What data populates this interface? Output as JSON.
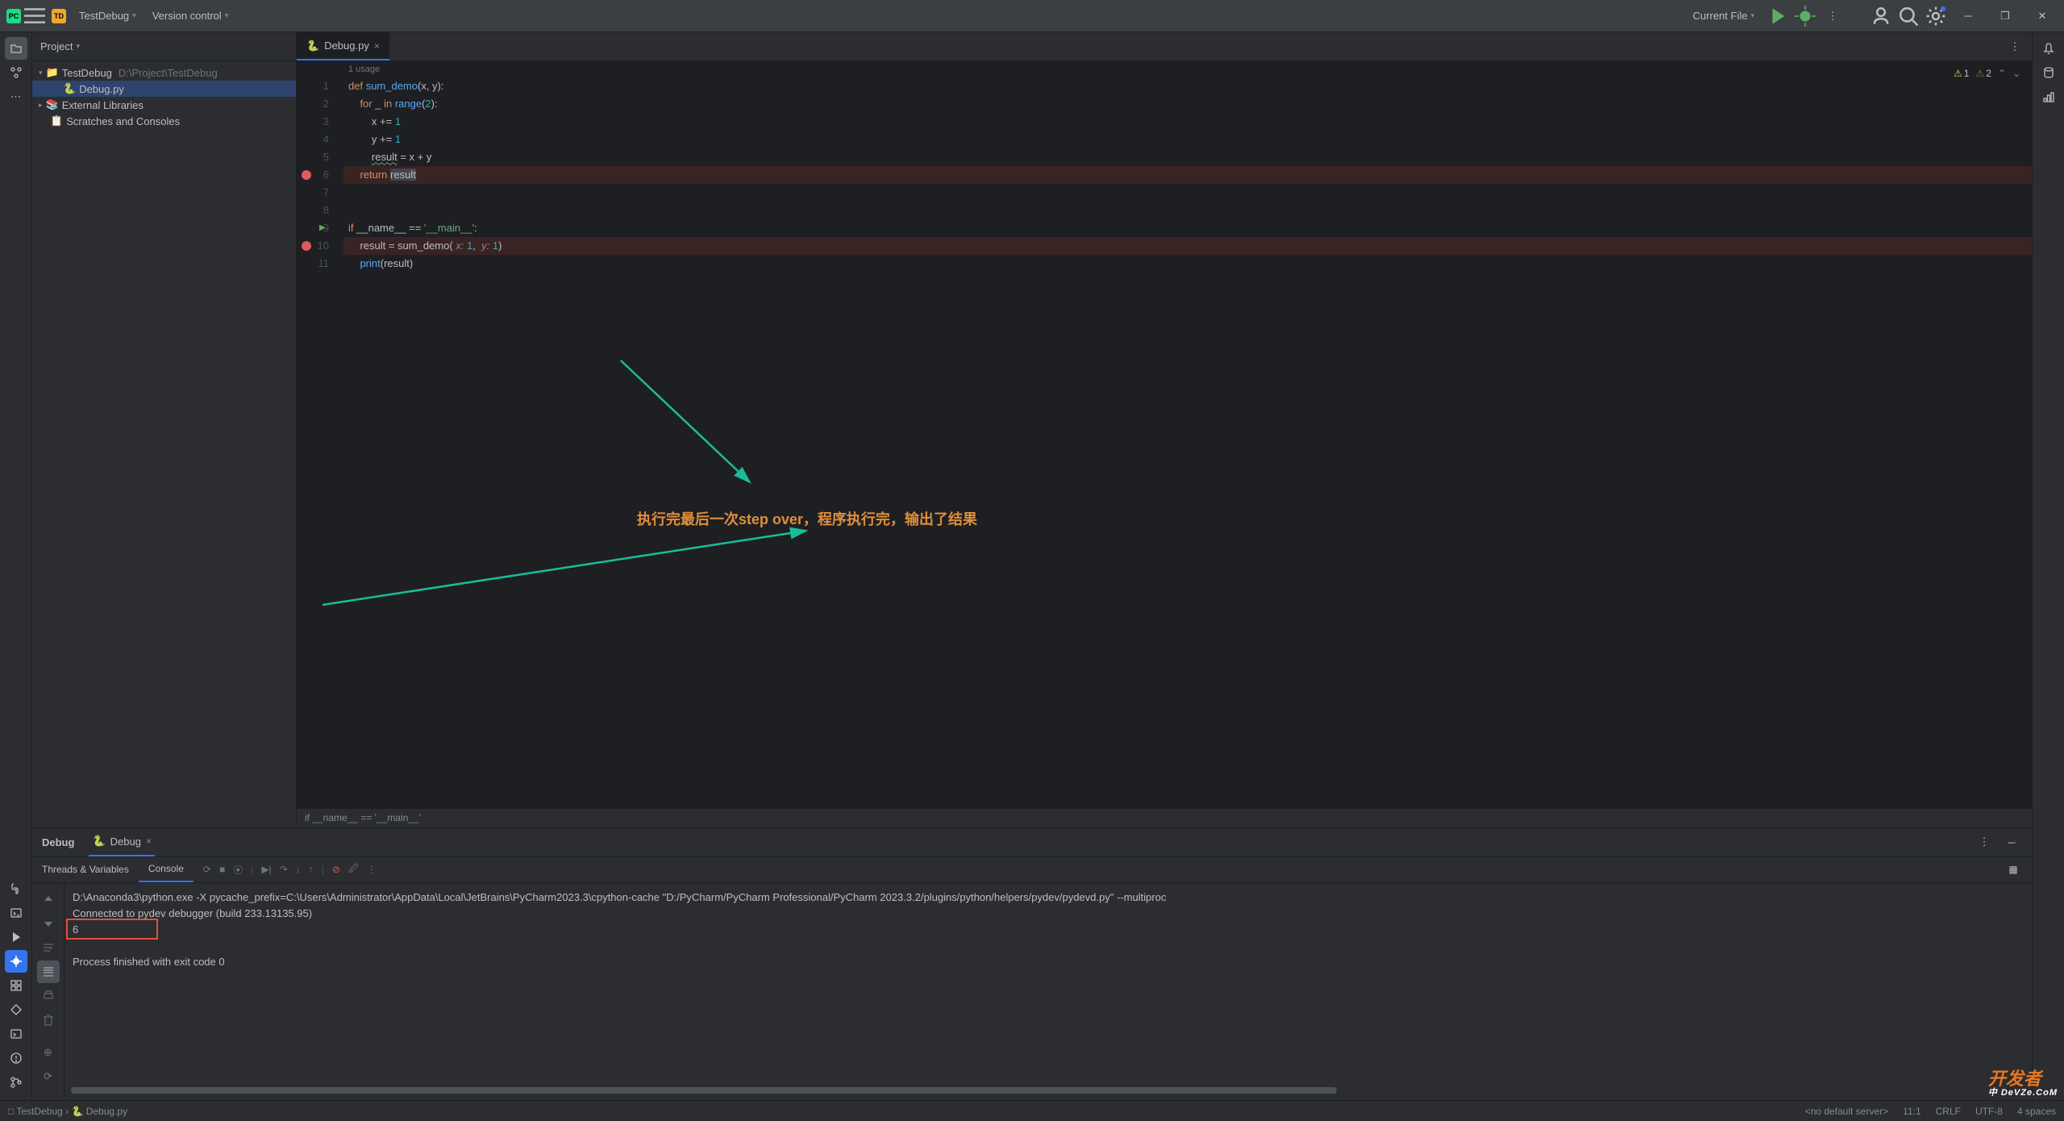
{
  "titlebar": {
    "project_name": "TestDebug",
    "vcs_label": "Version control",
    "run_config": "Current File"
  },
  "project_panel": {
    "header": "Project",
    "root_name": "TestDebug",
    "root_path": "D:\\Project\\TestDebug",
    "file1": "Debug.py",
    "ext_libs": "External Libraries",
    "scratches": "Scratches and Consoles"
  },
  "editor": {
    "tab_name": "Debug.py",
    "usages": "1 usage",
    "warnings_count": "1",
    "weak_warnings_count": "2",
    "breadcrumb": "if __name__ == '__main__'",
    "lines": {
      "l1a": "def ",
      "l1b": "sum_demo",
      "l1c": "(x, y):",
      "l2a": "    for ",
      "l2b": "_ ",
      "l2c": "in ",
      "l2d": "range",
      "l2e": "(",
      "l2f": "2",
      "l2g": "):",
      "l3a": "        x += ",
      "l3b": "1",
      "l4a": "        y += ",
      "l4b": "1",
      "l5a": "        ",
      "l5b": "result",
      "l5c": " = x + y",
      "l6a": "    return ",
      "l6b": "result",
      "l9a": "if ",
      "l9b": "__name__ == ",
      "l9c": "'__main__'",
      "l9d": ":",
      "l10a": "    result = sum_demo(",
      "l10b": " x: ",
      "l10c": "1",
      "l10d": ", ",
      "l10e": " y: ",
      "l10f": "1",
      "l10g": ")",
      "l11a": "    ",
      "l11b": "print",
      "l11c": "(result)"
    },
    "gutter_nums": [
      "1",
      "2",
      "3",
      "4",
      "5",
      "6",
      "7",
      "8",
      "9",
      "10",
      "11"
    ]
  },
  "debug_panel": {
    "title": "Debug",
    "run_tab": "Debug",
    "subtab_threads": "Threads & Variables",
    "subtab_console": "Console",
    "console_line1": "D:\\Anaconda3\\python.exe -X pycache_prefix=C:\\Users\\Administrator\\AppData\\Local\\JetBrains\\PyCharm2023.3\\cpython-cache \"D:/PyCharm/PyCharm Professional/PyCharm 2023.3.2/plugins/python/helpers/pydev/pydevd.py\" --multiproc",
    "console_line2": "Connected to pydev debugger (build 233.13135.95)",
    "console_line3": "6",
    "console_line4": "Process finished with exit code 0"
  },
  "status_bar": {
    "breadcrumb_root": "TestDebug",
    "breadcrumb_file": "Debug.py",
    "server": "<no default server>",
    "cursor": "11:1",
    "line_sep": "CRLF",
    "encoding": "UTF-8",
    "indent": "4 spaces"
  },
  "annotation": {
    "text": "执行完最后一次step over，程序执行完，输出了结果"
  }
}
